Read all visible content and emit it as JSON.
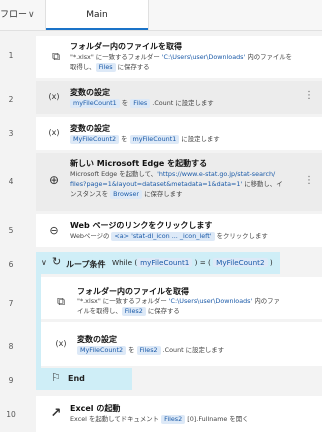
{
  "tabs": {
    "left_label": "フロー",
    "main_label": "Main"
  },
  "rows": [
    {
      "num": "1",
      "title": "フォルダー内のファイルを取得",
      "desc_a": "\"*.xlsx\" に一致するフォルダー ",
      "desc_path": "'C:\\Users\\user\\Downloads'",
      "desc_b": " 内のファイルを",
      "desc_c": "取得し、",
      "var": "Files",
      "desc_d": " に保存する"
    },
    {
      "num": "2",
      "title": "変数の設定",
      "var1": "myFileCount1",
      "mid": " を ",
      "var2": "Files",
      "tail": " .Count に設定します"
    },
    {
      "num": "3",
      "title": "変数の設定",
      "var1": "MyFileCount2",
      "mid": " を ",
      "var2": "myFileCount1",
      "tail": " に設定します"
    },
    {
      "num": "4",
      "title": "新しい Microsoft Edge を起動する",
      "line1a": "Microsoft Edge を起動して、",
      "line1b": "'https://www.e-stat.go.jp/stat-search/",
      "line2a": "files?page=1&layout=dataset&metadata=1&data=1'",
      "line2b": " に移動し、イ",
      "line3a": "ンスタンスを ",
      "var": "Browser",
      "line3b": " に保存します"
    },
    {
      "num": "5",
      "title": "Web ページのリンクをクリックします",
      "desc_a": "Webページの ",
      "tag": "<a> 'stat-dl_icon ... _icon_left'",
      "desc_b": " をクリックします"
    },
    {
      "num": "6",
      "title": "ループ条件",
      "kw": "While (",
      "var1": "myFileCount1",
      "op": " ) = ( ",
      "var2": "MyFileCount2",
      "close": " )"
    },
    {
      "num": "7",
      "title": "フォルダー内のファイルを取得",
      "desc_a": "\"*.xlsx\" に一致するフォルダー ",
      "desc_path": "'C:\\Users\\user\\Downloads'",
      "desc_b": " 内のファ",
      "desc_c": "イルを取得し、",
      "var": "Files2",
      "desc_d": " に保存する"
    },
    {
      "num": "8",
      "title": "変数の設定",
      "var1": "MyFileCount2",
      "mid": " を ",
      "var2": "Files2",
      "tail": " .Count に設定します"
    },
    {
      "num": "9",
      "title": "End"
    },
    {
      "num": "10",
      "title": "Excel の起動",
      "desc_a": "Excel を起動してドキュメント ",
      "var": "Files2",
      "desc_b": " [0].Fullname を開く"
    }
  ]
}
